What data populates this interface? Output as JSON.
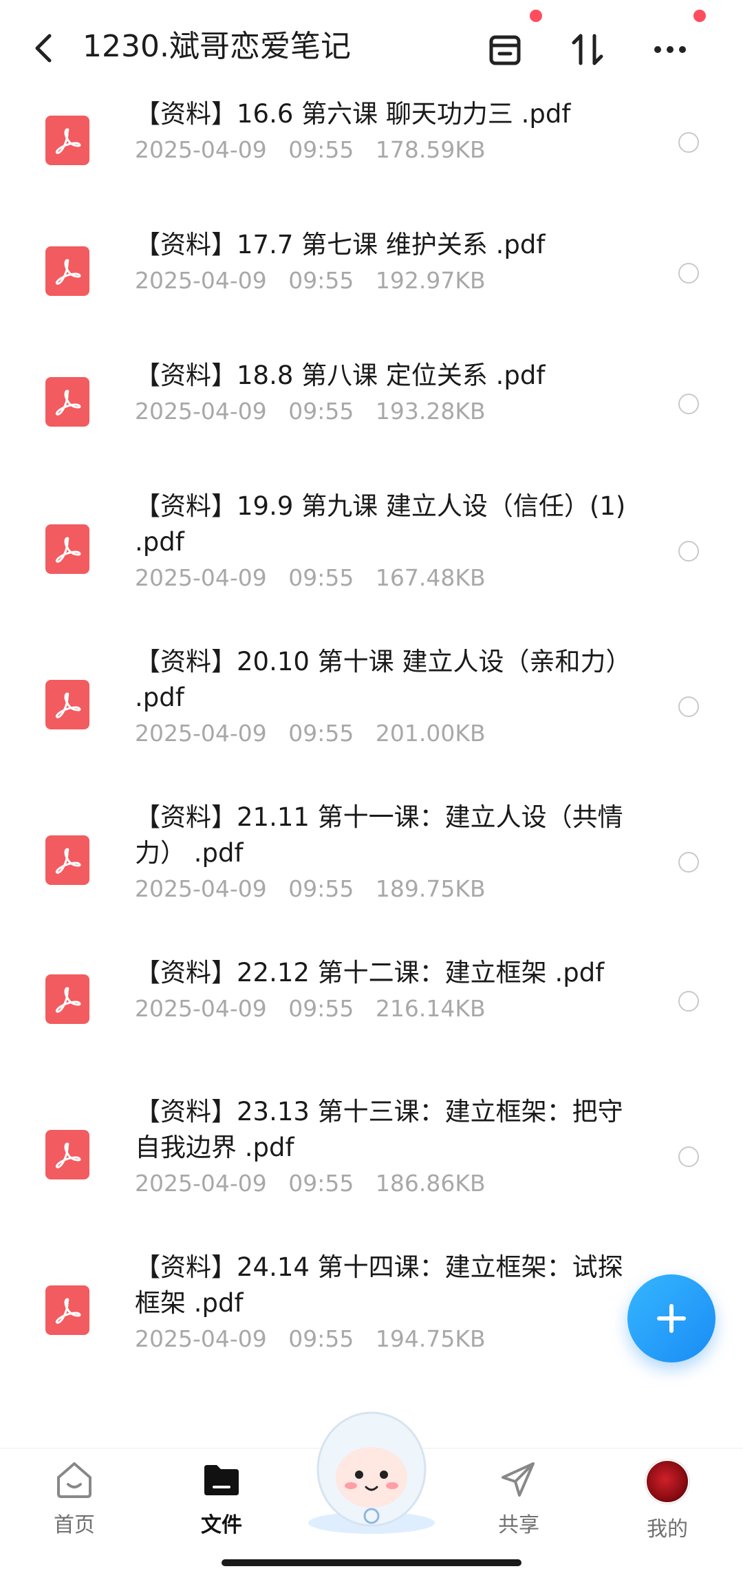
{
  "header": {
    "title": "1230.斌哥恋爱笔记",
    "icons": [
      "back-arrow-icon",
      "archive-icon",
      "sort-icon",
      "more-icon"
    ]
  },
  "files": [
    {
      "name": "【资料】16.6 第六课 聊天功力三 .pdf",
      "date": "2025-04-09",
      "time": "09:55",
      "size": "178.59KB"
    },
    {
      "name": "【资料】17.7 第七课 维护关系 .pdf",
      "date": "2025-04-09",
      "time": "09:55",
      "size": "192.97KB"
    },
    {
      "name": "【资料】18.8 第八课 定位关系 .pdf",
      "date": "2025-04-09",
      "time": "09:55",
      "size": "193.28KB"
    },
    {
      "name": "【资料】19.9 第九课 建立人设（信任）(1) .pdf",
      "date": "2025-04-09",
      "time": "09:55",
      "size": "167.48KB"
    },
    {
      "name": "【资料】20.10 第十课 建立人设（亲和力） .pdf",
      "date": "2025-04-09",
      "time": "09:55",
      "size": "201.00KB"
    },
    {
      "name": "【资料】21.11 第十一课：建立人设（共情力） .pdf",
      "date": "2025-04-09",
      "time": "09:55",
      "size": "189.75KB"
    },
    {
      "name": "【资料】22.12 第十二课：建立框架 .pdf",
      "date": "2025-04-09",
      "time": "09:55",
      "size": "216.14KB"
    },
    {
      "name": "【资料】23.13 第十三课：建立框架：把守自我边界 .pdf",
      "date": "2025-04-09",
      "time": "09:55",
      "size": "186.86KB"
    },
    {
      "name": "【资料】24.14 第十四课：建立框架：试探框架 .pdf",
      "date": "2025-04-09",
      "time": "09:55",
      "size": "194.75KB"
    }
  ],
  "nav": {
    "home": "首页",
    "files": "文件",
    "share": "共享",
    "mine": "我的"
  },
  "colors": {
    "pdf_icon": "#f25b5f",
    "fab": "#1a8cf5",
    "badge": "#ff4d5e"
  }
}
